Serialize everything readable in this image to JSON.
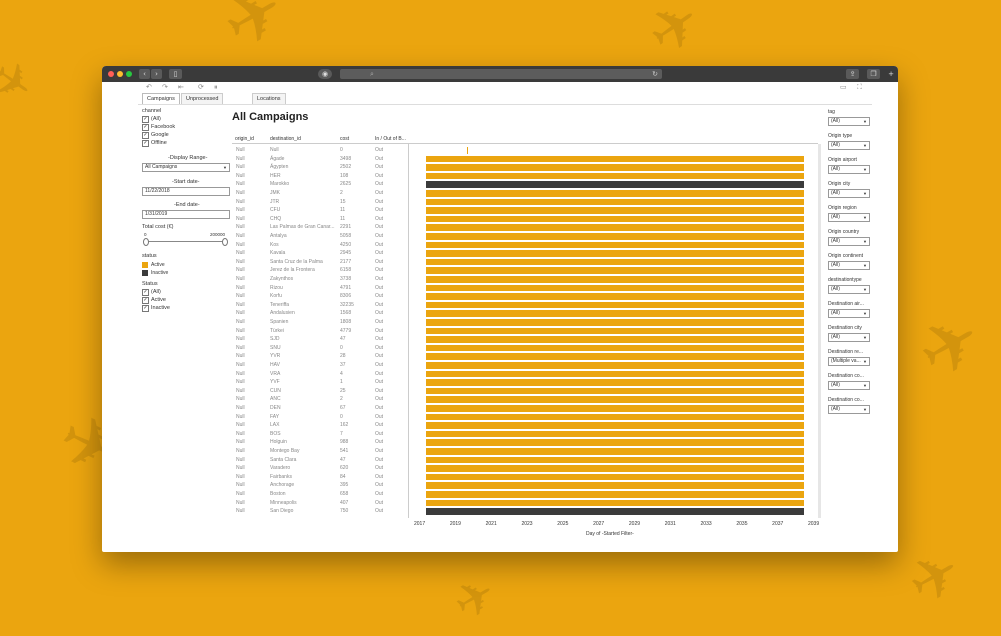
{
  "toolbar": {
    "tabs": [
      "Campaigns",
      "Unprocessed campaigns",
      "Locations"
    ]
  },
  "filters": {
    "channel_title": "channel",
    "channel_options": [
      "(All)",
      "Facebook",
      "Google",
      "Offline"
    ],
    "display_range_title": "-Display Range-",
    "display_range_value": "All Campaigns",
    "start_date_title": "-Start date-",
    "start_date_value": "11/22/2018",
    "end_date_title": "-End date-",
    "end_date_value": "1/31/2019",
    "total_cost_title": "Total cost (€)",
    "total_cost_min": "0",
    "total_cost_max": "200000",
    "status_legend_title": "status",
    "status_legend": [
      {
        "label": "Active",
        "color": "#eba50f"
      },
      {
        "label": "Inactive",
        "color": "#3b3b3b"
      }
    ],
    "status_filter_title": "Status",
    "status_filter_options": [
      "(All)",
      "Active",
      "Inactive"
    ]
  },
  "main": {
    "title": "All Campaigns",
    "columns": [
      "origin_id",
      "destination_id",
      "cost",
      "In / Out of B..."
    ],
    "rows": [
      {
        "origin": "Null",
        "dest": "Null",
        "cost": "0",
        "inout": "Out",
        "status": "none"
      },
      {
        "origin": "Null",
        "dest": "Ägade",
        "cost": "3498",
        "inout": "Out",
        "status": "active"
      },
      {
        "origin": "Null",
        "dest": "Ägypten",
        "cost": "2502",
        "inout": "Out",
        "status": "active"
      },
      {
        "origin": "Null",
        "dest": "HER",
        "cost": "108",
        "inout": "Out",
        "status": "active"
      },
      {
        "origin": "Null",
        "dest": "Marokko",
        "cost": "2625",
        "inout": "Out",
        "status": "inactive"
      },
      {
        "origin": "Null",
        "dest": "JMK",
        "cost": "2",
        "inout": "Out",
        "status": "active"
      },
      {
        "origin": "Null",
        "dest": "JTR",
        "cost": "15",
        "inout": "Out",
        "status": "active"
      },
      {
        "origin": "Null",
        "dest": "CFU",
        "cost": "11",
        "inout": "Out",
        "status": "active"
      },
      {
        "origin": "Null",
        "dest": "CHQ",
        "cost": "11",
        "inout": "Out",
        "status": "active"
      },
      {
        "origin": "Null",
        "dest": "Las Palmas de Gran Canar...",
        "cost": "2291",
        "inout": "Out",
        "status": "active"
      },
      {
        "origin": "Null",
        "dest": "Antalya",
        "cost": "5058",
        "inout": "Out",
        "status": "active"
      },
      {
        "origin": "Null",
        "dest": "Kos",
        "cost": "4250",
        "inout": "Out",
        "status": "active"
      },
      {
        "origin": "Null",
        "dest": "Kavala",
        "cost": "2945",
        "inout": "Out",
        "status": "active"
      },
      {
        "origin": "Null",
        "dest": "Santa Cruz de la Palma",
        "cost": "2177",
        "inout": "Out",
        "status": "active"
      },
      {
        "origin": "Null",
        "dest": "Jerez de la Frontera",
        "cost": "6158",
        "inout": "Out",
        "status": "active"
      },
      {
        "origin": "Null",
        "dest": "Zakynthos",
        "cost": "3738",
        "inout": "Out",
        "status": "active"
      },
      {
        "origin": "Null",
        "dest": "Rizou",
        "cost": "4791",
        "inout": "Out",
        "status": "active"
      },
      {
        "origin": "Null",
        "dest": "Korfu",
        "cost": "8306",
        "inout": "Out",
        "status": "active"
      },
      {
        "origin": "Null",
        "dest": "Teneriffa",
        "cost": "32235",
        "inout": "Out",
        "status": "active"
      },
      {
        "origin": "Null",
        "dest": "Andalusien",
        "cost": "1568",
        "inout": "Out",
        "status": "active"
      },
      {
        "origin": "Null",
        "dest": "Spanien",
        "cost": "1808",
        "inout": "Out",
        "status": "active"
      },
      {
        "origin": "Null",
        "dest": "Türkei",
        "cost": "4779",
        "inout": "Out",
        "status": "active"
      },
      {
        "origin": "Null",
        "dest": "SJD",
        "cost": "47",
        "inout": "Out",
        "status": "active"
      },
      {
        "origin": "Null",
        "dest": "SNU",
        "cost": "0",
        "inout": "Out",
        "status": "active"
      },
      {
        "origin": "Null",
        "dest": "YVR",
        "cost": "28",
        "inout": "Out",
        "status": "active"
      },
      {
        "origin": "Null",
        "dest": "HAV",
        "cost": "37",
        "inout": "Out",
        "status": "active"
      },
      {
        "origin": "Null",
        "dest": "VRA",
        "cost": "4",
        "inout": "Out",
        "status": "active"
      },
      {
        "origin": "Null",
        "dest": "YVF",
        "cost": "1",
        "inout": "Out",
        "status": "active"
      },
      {
        "origin": "Null",
        "dest": "CUN",
        "cost": "25",
        "inout": "Out",
        "status": "active"
      },
      {
        "origin": "Null",
        "dest": "ANC",
        "cost": "2",
        "inout": "Out",
        "status": "active"
      },
      {
        "origin": "Null",
        "dest": "DEN",
        "cost": "67",
        "inout": "Out",
        "status": "active"
      },
      {
        "origin": "Null",
        "dest": "FAY",
        "cost": "0",
        "inout": "Out",
        "status": "active"
      },
      {
        "origin": "Null",
        "dest": "LAX",
        "cost": "162",
        "inout": "Out",
        "status": "active"
      },
      {
        "origin": "Null",
        "dest": "BOS",
        "cost": "7",
        "inout": "Out",
        "status": "active"
      },
      {
        "origin": "Null",
        "dest": "Holguin",
        "cost": "988",
        "inout": "Out",
        "status": "active"
      },
      {
        "origin": "Null",
        "dest": "Montego Bay",
        "cost": "541",
        "inout": "Out",
        "status": "active"
      },
      {
        "origin": "Null",
        "dest": "Santa Clara",
        "cost": "47",
        "inout": "Out",
        "status": "active"
      },
      {
        "origin": "Null",
        "dest": "Varadero",
        "cost": "620",
        "inout": "Out",
        "status": "active"
      },
      {
        "origin": "Null",
        "dest": "Fairbanks",
        "cost": "84",
        "inout": "Out",
        "status": "active"
      },
      {
        "origin": "Null",
        "dest": "Anchorage",
        "cost": "395",
        "inout": "Out",
        "status": "active"
      },
      {
        "origin": "Null",
        "dest": "Boston",
        "cost": "658",
        "inout": "Out",
        "status": "active"
      },
      {
        "origin": "Null",
        "dest": "Minneapolis",
        "cost": "407",
        "inout": "Out",
        "status": "active"
      },
      {
        "origin": "Null",
        "dest": "San Diego",
        "cost": "750",
        "inout": "Out",
        "status": "inactive"
      }
    ],
    "axis_ticks": [
      "2017",
      "2019",
      "2021",
      "2023",
      "2025",
      "2027",
      "2029",
      "2031",
      "2033",
      "2035",
      "2037",
      "2039"
    ],
    "axis_title": "Day of -Started Filter-"
  },
  "right_filters": [
    {
      "label": "tag",
      "value": "(All)"
    },
    {
      "label": "Origin type",
      "value": "(All)"
    },
    {
      "label": "Origin airport",
      "value": "(All)"
    },
    {
      "label": "Origin city",
      "value": "(All)"
    },
    {
      "label": "Origin region",
      "value": "(All)"
    },
    {
      "label": "Origin country",
      "value": "(All)"
    },
    {
      "label": "Origin continent",
      "value": "(All)"
    },
    {
      "label": "destinationtype",
      "value": "(All)"
    },
    {
      "label": "Destination air...",
      "value": "(All)"
    },
    {
      "label": "Destination city",
      "value": "(All)"
    },
    {
      "label": "Destination re...",
      "value": "(Multiple va..."
    },
    {
      "label": "Destination co...",
      "value": "(All)"
    },
    {
      "label": "Destination co...",
      "value": "(All)"
    }
  ],
  "colors": {
    "active": "#eba50f",
    "inactive": "#3b3b3b",
    "background": "#eba50f"
  }
}
